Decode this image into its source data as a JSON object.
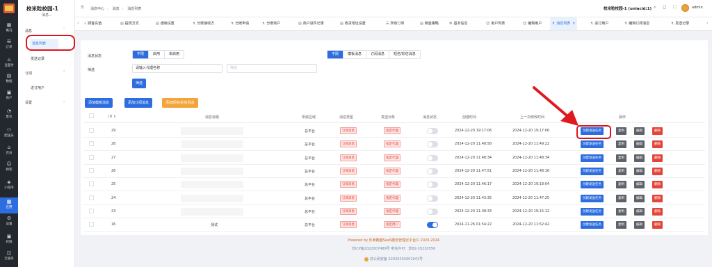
{
  "rail": [
    {
      "icon": "overview-icon",
      "glyph": "▦",
      "label": "概况"
    },
    {
      "icon": "order-icon",
      "glyph": "☰",
      "label": "订单"
    },
    {
      "icon": "storefront-icon",
      "glyph": "⌂",
      "label": "当面付"
    },
    {
      "icon": "data-icon",
      "glyph": "▤",
      "label": "数据"
    },
    {
      "icon": "merchant-icon",
      "glyph": "▣",
      "label": "商户"
    },
    {
      "icon": "rider-icon",
      "glyph": "◔",
      "label": "集包"
    },
    {
      "icon": "courier-icon",
      "glyph": "⚇",
      "label": "配送员"
    },
    {
      "icon": "shop-icon",
      "glyph": "⌂",
      "label": "店员"
    },
    {
      "icon": "customer-icon",
      "glyph": "☺",
      "label": "顾客"
    },
    {
      "icon": "miniprogram-icon",
      "glyph": "◈",
      "label": "小程序"
    },
    {
      "icon": "app-icon",
      "glyph": "▩",
      "label": "应用"
    },
    {
      "icon": "settings-icon",
      "glyph": "⚙",
      "label": "设置"
    },
    {
      "icon": "permission-icon",
      "glyph": "▣",
      "label": "权限"
    },
    {
      "icon": "cloud-print-icon",
      "glyph": "◫",
      "label": "云服务"
    }
  ],
  "sidebar": {
    "brand": "校米粒校园-1",
    "brand_sub": "消息...",
    "group1": "消息",
    "item_active": "消息列表",
    "item2": "发送记录",
    "group2": "订阅",
    "item3": "进订用户",
    "group3": "设置"
  },
  "topbar": {
    "crumb1": "消息中心",
    "crumb2": "消息",
    "crumb3": "消息列表",
    "school": "校米粒校园-1 (uniacid:1)",
    "tools": "⌕ ◻ ⛶",
    "username": "admin"
  },
  "tabs": [
    {
      "label": "顾客充值",
      "icon": "↓"
    },
    {
      "label": "提现方式",
      "icon": "▤"
    },
    {
      "label": "通用设置",
      "icon": "▤"
    },
    {
      "label": "分账接收方",
      "icon": "↯"
    },
    {
      "label": "分账申请",
      "icon": "↯"
    },
    {
      "label": "分账商户",
      "icon": "↯"
    },
    {
      "label": "商户进件记录",
      "icon": "▤"
    },
    {
      "label": "收货地址设置",
      "icon": "▤"
    },
    {
      "label": "所有订单",
      "icon": "☰"
    },
    {
      "label": "佣金策略",
      "icon": "▤"
    },
    {
      "label": "基本信息",
      "icon": "⚙"
    },
    {
      "label": "用户列表",
      "icon": "☺"
    },
    {
      "label": "编辑用户",
      "icon": "☺"
    },
    {
      "label": "消息列表",
      "icon": "↯"
    },
    {
      "label": "进订用户",
      "icon": "↯"
    },
    {
      "label": "编辑订阅消息",
      "icon": "↯"
    },
    {
      "label": "发送记录",
      "icon": "↯"
    }
  ],
  "filters": {
    "status_label": "消息状态",
    "status_options": [
      "不限",
      "启用",
      "未启用"
    ],
    "type_options": [
      "不限",
      "模板消息",
      "订阅消息",
      "短信/彩信消息"
    ],
    "filter_label": "筛选",
    "agent_placeholder": "请输入代理名称",
    "second_placeholder": "筛选",
    "filter_button": "筛选"
  },
  "actions": {
    "add_template": "添加模板消息",
    "add_subscribe": "添加订阅消息",
    "add_sms": "添加短信/彩信消息"
  },
  "table": {
    "headers": [
      "ID ⇕",
      "消息标题",
      "所属区域",
      "消息类型",
      "发送对象",
      "消息状态",
      "创建时间",
      "上一次修改时间",
      "操作"
    ],
    "rows": [
      {
        "id": "29",
        "title": "",
        "area": "总平台",
        "type": "订阅消息",
        "target": "指定代理",
        "enabled": false,
        "created": "2024-12-20 19:17:06",
        "updated": "2024-12-20 19:17:06"
      },
      {
        "id": "28",
        "title": "",
        "area": "总平台",
        "type": "订阅消息",
        "target": "指定代理",
        "enabled": false,
        "created": "2024-12-20 11:48:58",
        "updated": "2024-12-20 11:49:22"
      },
      {
        "id": "27",
        "title": "",
        "area": "总平台",
        "type": "订阅消息",
        "target": "指定代理",
        "enabled": false,
        "created": "2024-12-20 11:48:34",
        "updated": "2024-12-20 11:48:34"
      },
      {
        "id": "26",
        "title": "",
        "area": "总平台",
        "type": "订阅消息",
        "target": "指定代理",
        "enabled": false,
        "created": "2024-12-20 11:47:51",
        "updated": "2024-12-20 11:48:16"
      },
      {
        "id": "25",
        "title": "",
        "area": "总平台",
        "type": "订阅消息",
        "target": "指定代理",
        "enabled": false,
        "created": "2024-12-20 11:46:17",
        "updated": "2024-12-20 19:18:04"
      },
      {
        "id": "24",
        "title": "",
        "area": "总平台",
        "type": "订阅消息",
        "target": "指定代理",
        "enabled": false,
        "created": "2024-12-20 11:43:35",
        "updated": "2024-12-20 11:47:25"
      },
      {
        "id": "23",
        "title": "",
        "area": "总平台",
        "type": "订阅消息",
        "target": "指定代理",
        "enabled": false,
        "created": "2024-12-20 11:38:33",
        "updated": "2024-12-20 19:15:12"
      },
      {
        "id": "16",
        "title": "测试",
        "area": "总平台",
        "type": "订阅消息",
        "target": "指定用户",
        "enabled": true,
        "created": "2024-11-26 01:54:22",
        "updated": "2024-12-20 11:52:42"
      }
    ],
    "row_actions": [
      "创建发送任务",
      "复制",
      "编辑",
      "删除"
    ]
  },
  "footer": {
    "powered": "Powered by 外卖跑腿SaaS服务管理云平台© 2020-2024",
    "icp": "苏ICP备2022007489号    电信许可：苏B2-20220556",
    "police": "苏公网安备 32030302001041号"
  },
  "colors": {
    "primary": "#2d6de0",
    "danger": "#e2463b",
    "highlight": "#d8171c",
    "warning": "#f3a43a"
  }
}
